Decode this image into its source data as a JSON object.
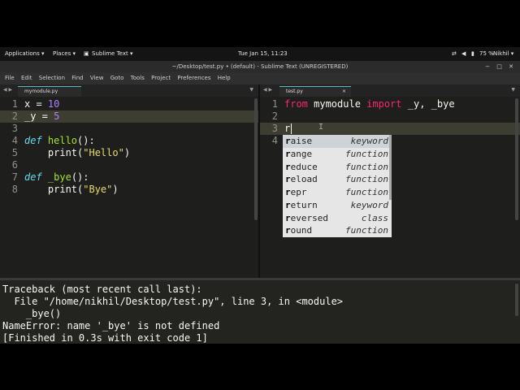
{
  "topbar": {
    "applications": "Applications ▾",
    "places": "Places ▾",
    "app": "Sublime Text ▾",
    "clock": "Tue Jan 15, 11:23",
    "battery": "75 %",
    "user": "Nikhil ▾"
  },
  "window": {
    "title": "~/Desktop/test.py • (default) - Sublime Text (UNREGISTERED)"
  },
  "menu": [
    "File",
    "Edit",
    "Selection",
    "Find",
    "View",
    "Goto",
    "Tools",
    "Project",
    "Preferences",
    "Help"
  ],
  "left_pane": {
    "tab": "mymodule.py",
    "lines": [
      {
        "n": "1"
      },
      {
        "n": "2"
      },
      {
        "n": "3"
      },
      {
        "n": "4"
      },
      {
        "n": "5"
      },
      {
        "n": "6"
      },
      {
        "n": "7"
      },
      {
        "n": "8"
      }
    ],
    "text": {
      "l1_var": "x = ",
      "l1_num": "10",
      "l2_var": "_y = ",
      "l2_num": "5",
      "l4_def": "def",
      "l4_name": " hello",
      "l4_rest": "():",
      "l5_call": "    print(",
      "l5_str": "\"Hello\"",
      "l5_end": ")",
      "l7_def": "def",
      "l7_name": " _bye",
      "l7_rest": "():",
      "l8_call": "    print(",
      "l8_str": "\"Bye\"",
      "l8_end": ")"
    }
  },
  "right_pane": {
    "tab": "test.py",
    "tab_close": "×",
    "lines": [
      {
        "n": "1"
      },
      {
        "n": "2"
      },
      {
        "n": "3"
      },
      {
        "n": "4"
      }
    ],
    "text": {
      "l1_from": "from",
      "l1_mod": " mymodule ",
      "l1_import": "import",
      "l1_names": " _y, _bye",
      "l3_typed": "r"
    }
  },
  "autocomplete": [
    {
      "first": "r",
      "rest": "aise",
      "kind": "keyword"
    },
    {
      "first": "r",
      "rest": "ange",
      "kind": "function"
    },
    {
      "first": "r",
      "rest": "educe",
      "kind": "function"
    },
    {
      "first": "r",
      "rest": "eload",
      "kind": "function"
    },
    {
      "first": "r",
      "rest": "epr",
      "kind": "function"
    },
    {
      "first": "r",
      "rest": "eturn",
      "kind": "keyword"
    },
    {
      "first": "r",
      "rest": "eversed",
      "kind": "class"
    },
    {
      "first": "r",
      "rest": "ound",
      "kind": "function"
    }
  ],
  "output": [
    "Traceback (most recent call last):",
    "  File \"/home/nikhil/Desktop/test.py\", line 3, in <module>",
    "    _bye()",
    "NameError: name '_bye' is not defined",
    "[Finished in 0.3s with exit code 1]"
  ],
  "colors": {
    "accent": "#5fb3b3",
    "keyword": "#f92672",
    "function": "#a6e22e",
    "number": "#ae81ff",
    "string": "#e6db74"
  }
}
